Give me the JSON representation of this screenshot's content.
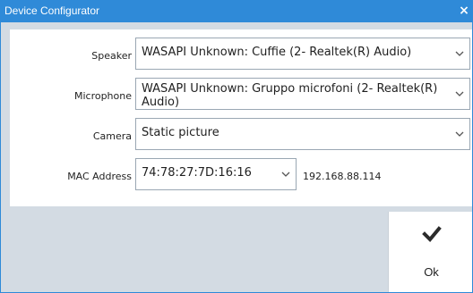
{
  "window": {
    "title": "Device Configurator",
    "close_glyph": "×"
  },
  "form": {
    "speaker": {
      "label": "Speaker",
      "value": "WASAPI Unknown: Cuffie (2- Realtek(R) Audio)"
    },
    "microphone": {
      "label": "Microphone",
      "value": "WASAPI Unknown: Gruppo microfoni (2- Realtek(R) Audio)"
    },
    "camera": {
      "label": "Camera",
      "value": "Static picture"
    },
    "mac": {
      "label": "MAC Address",
      "value": "74:78:27:7D:16:16",
      "ip": "192.168.88.114"
    }
  },
  "actions": {
    "ok_label": "Ok"
  },
  "colors": {
    "titlebar": "#2f8ad8",
    "background": "#d3dbe3",
    "panel": "#ffffff"
  },
  "icons": {
    "close": "close-icon",
    "dropdown": "chevron-down-icon",
    "ok": "checkmark-icon"
  }
}
